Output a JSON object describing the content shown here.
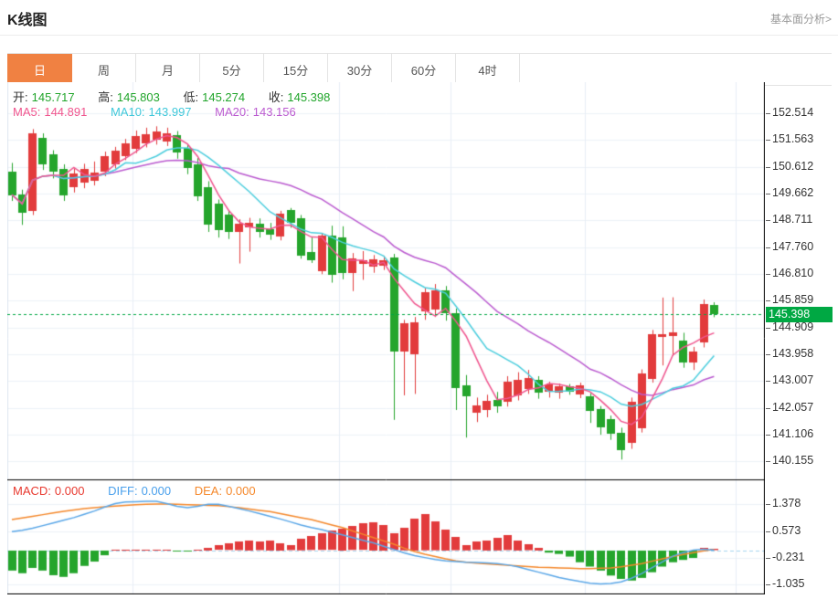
{
  "page": {
    "title": "K线图",
    "link": "基本面分析>"
  },
  "tabs": {
    "items": [
      "日",
      "周",
      "月",
      "5分",
      "15分",
      "30分",
      "60分",
      "4时"
    ],
    "active_index": 0
  },
  "ohlc": {
    "open_label": "开:",
    "open": "145.717",
    "high_label": "高:",
    "high": "145.803",
    "low_label": "低:",
    "low": "145.274",
    "close_label": "收:",
    "close": "145.398"
  },
  "ma_legend": {
    "ma5_label": "MA5:",
    "ma5": "144.891",
    "ma10_label": "MA10:",
    "ma10": "143.997",
    "ma20_label": "MA20:",
    "ma20": "143.156"
  },
  "macd_legend": {
    "macd_label": "MACD:",
    "macd": "0.000",
    "diff_label": "DIFF:",
    "diff": "0.000",
    "dea_label": "DEA:",
    "dea": "0.000"
  },
  "price_badge": "145.398",
  "colors": {
    "up": "#e23b3c",
    "down": "#25a52c",
    "ma5": "#f0558e",
    "ma10": "#4ccede",
    "ma20": "#bb5bd0",
    "diff": "#5aa7e8",
    "dea": "#f5882b",
    "badge_bg": "#00a843",
    "price_line": "#00a843",
    "grid": "#edf2f8",
    "vgrid": "#e8eef6",
    "axis": "#000000",
    "zero_dash": "#a5d5f0",
    "tab_accent": "#f08142"
  },
  "chart_data": {
    "type": "candlestick",
    "title": "K线图 (日K)",
    "price_axis_ticks": [
      "152.514",
      "151.563",
      "150.612",
      "149.662",
      "148.711",
      "147.760",
      "146.810",
      "145.859",
      "144.909",
      "143.958",
      "143.007",
      "142.057",
      "141.106",
      "140.155"
    ],
    "price_tick_top": 152.514,
    "price_tick_step": 0.9507,
    "macd_axis_ticks": [
      "1.378",
      "0.573",
      "-0.231",
      "-1.035"
    ],
    "current_price": 145.398,
    "ma_periods": [
      5,
      10,
      20
    ],
    "legend": [
      "MA5",
      "MA10",
      "MA20",
      "MACD",
      "DIFF",
      "DEA"
    ],
    "candles_ohlc": [
      [
        150.45,
        150.75,
        149.4,
        149.62
      ],
      [
        149.62,
        149.8,
        148.55,
        148.98
      ],
      [
        149.05,
        151.95,
        148.9,
        151.8
      ],
      [
        151.65,
        151.8,
        150.5,
        150.72
      ],
      [
        151.05,
        151.2,
        150.2,
        150.42
      ],
      [
        150.55,
        150.7,
        149.4,
        149.62
      ],
      [
        149.9,
        150.55,
        149.7,
        150.38
      ],
      [
        150.05,
        150.72,
        149.85,
        150.55
      ],
      [
        150.12,
        150.8,
        149.95,
        150.42
      ],
      [
        150.42,
        151.15,
        150.28,
        150.98
      ],
      [
        150.7,
        151.32,
        150.55,
        151.18
      ],
      [
        151.0,
        151.6,
        150.85,
        151.45
      ],
      [
        151.25,
        151.9,
        151.1,
        151.7
      ],
      [
        151.45,
        152.0,
        151.3,
        151.78
      ],
      [
        151.55,
        152.05,
        151.4,
        151.85
      ],
      [
        151.5,
        152.0,
        151.35,
        151.8
      ],
      [
        151.72,
        151.88,
        150.9,
        151.1
      ],
      [
        151.28,
        151.4,
        150.35,
        150.58
      ],
      [
        150.7,
        150.92,
        149.4,
        149.55
      ],
      [
        149.88,
        150.1,
        148.3,
        148.55
      ],
      [
        149.3,
        149.45,
        148.1,
        148.35
      ],
      [
        148.9,
        149.05,
        148.05,
        148.28
      ],
      [
        148.3,
        148.75,
        147.18,
        148.58
      ],
      [
        148.45,
        148.8,
        147.6,
        148.62
      ],
      [
        148.6,
        148.78,
        148.1,
        148.3
      ],
      [
        148.4,
        148.62,
        148.02,
        148.22
      ],
      [
        148.15,
        149.05,
        148.0,
        148.95
      ],
      [
        149.08,
        149.15,
        148.45,
        148.62
      ],
      [
        148.8,
        148.9,
        147.35,
        147.48
      ],
      [
        147.6,
        148.1,
        147.2,
        147.32
      ],
      [
        146.92,
        148.25,
        146.8,
        148.18
      ],
      [
        148.18,
        148.52,
        146.5,
        146.78
      ],
      [
        148.12,
        148.5,
        146.62,
        146.85
      ],
      [
        146.82,
        147.55,
        146.2,
        147.35
      ],
      [
        147.18,
        147.62,
        146.6,
        147.3
      ],
      [
        147.05,
        147.48,
        146.85,
        147.32
      ],
      [
        147.1,
        147.45,
        146.95,
        147.28
      ],
      [
        147.38,
        147.52,
        141.63,
        144.05
      ],
      [
        144.04,
        145.18,
        142.5,
        145.05
      ],
      [
        143.98,
        145.28,
        142.55,
        145.1
      ],
      [
        145.48,
        146.32,
        145.18,
        146.15
      ],
      [
        145.55,
        146.45,
        145.28,
        146.22
      ],
      [
        146.22,
        146.38,
        145.15,
        145.42
      ],
      [
        145.4,
        145.58,
        141.98,
        142.75
      ],
      [
        142.85,
        143.22,
        141.0,
        142.45
      ],
      [
        141.88,
        142.42,
        141.55,
        142.15
      ],
      [
        141.98,
        142.52,
        141.72,
        142.3
      ],
      [
        142.32,
        142.62,
        141.88,
        142.08
      ],
      [
        142.28,
        143.18,
        142.1,
        142.98
      ],
      [
        142.5,
        143.32,
        142.32,
        143.05
      ],
      [
        142.72,
        143.4,
        142.55,
        143.12
      ],
      [
        143.05,
        143.18,
        142.38,
        142.58
      ],
      [
        142.62,
        142.98,
        142.42,
        142.88
      ],
      [
        142.58,
        142.92,
        142.38,
        142.82
      ],
      [
        142.82,
        142.9,
        142.52,
        142.62
      ],
      [
        142.52,
        142.95,
        142.4,
        142.85
      ],
      [
        142.48,
        142.58,
        141.52,
        141.95
      ],
      [
        142.02,
        142.12,
        141.1,
        141.38
      ],
      [
        141.65,
        141.78,
        140.92,
        141.12
      ],
      [
        141.18,
        141.35,
        140.22,
        140.58
      ],
      [
        140.82,
        142.42,
        140.6,
        142.28
      ],
      [
        141.32,
        143.42,
        141.18,
        143.28
      ],
      [
        143.1,
        144.82,
        142.95,
        144.68
      ],
      [
        144.55,
        145.97,
        143.56,
        144.66
      ],
      [
        144.58,
        145.98,
        143.9,
        144.72
      ],
      [
        144.45,
        144.72,
        143.48,
        143.66
      ],
      [
        143.66,
        144.22,
        143.4,
        144.06
      ],
      [
        144.39,
        145.9,
        144.2,
        145.74
      ],
      [
        145.717,
        145.803,
        145.274,
        145.398
      ]
    ],
    "macd": {
      "hist": [
        -0.6,
        -0.68,
        -0.52,
        -0.6,
        -0.74,
        -0.79,
        -0.68,
        -0.46,
        -0.33,
        -0.14,
        0.02,
        0.03,
        0.02,
        0.02,
        0.01,
        0.01,
        -0.01,
        -0.02,
        0.01,
        0.08,
        0.14,
        0.2,
        0.26,
        0.3,
        0.26,
        0.3,
        0.22,
        0.15,
        0.35,
        0.42,
        0.5,
        0.58,
        0.66,
        0.72,
        0.8,
        0.85,
        0.77,
        0.5,
        0.68,
        0.96,
        1.09,
        0.87,
        0.63,
        0.4,
        0.16,
        0.25,
        0.3,
        0.38,
        0.45,
        0.3,
        0.18,
        0.08,
        -0.06,
        -0.1,
        -0.18,
        -0.35,
        -0.48,
        -0.6,
        -0.75,
        -0.85,
        -0.9,
        -0.82,
        -0.65,
        -0.48,
        -0.35,
        -0.28,
        -0.22,
        0.06,
        0.04
      ],
      "diff": [
        0.56,
        0.6,
        0.66,
        0.74,
        0.82,
        0.9,
        0.98,
        1.08,
        1.18,
        1.3,
        1.4,
        1.45,
        1.46,
        1.47,
        1.47,
        1.4,
        1.32,
        1.28,
        1.32,
        1.38,
        1.38,
        1.32,
        1.25,
        1.18,
        1.1,
        1.02,
        0.94,
        0.85,
        0.76,
        0.68,
        0.62,
        0.54,
        0.46,
        0.38,
        0.3,
        0.22,
        0.12,
        0.02,
        -0.08,
        -0.16,
        -0.22,
        -0.28,
        -0.32,
        -0.34,
        -0.36,
        -0.37,
        -0.38,
        -0.4,
        -0.44,
        -0.5,
        -0.58,
        -0.66,
        -0.74,
        -0.82,
        -0.88,
        -0.94,
        -0.99,
        -1.01,
        -1.0,
        -0.95,
        -0.84,
        -0.7,
        -0.52,
        -0.35,
        -0.18,
        -0.07,
        0.0,
        0.03,
        0.0
      ],
      "dea": [
        0.92,
        0.97,
        1.02,
        1.07,
        1.12,
        1.17,
        1.21,
        1.25,
        1.28,
        1.31,
        1.33,
        1.35,
        1.37,
        1.38,
        1.39,
        1.39,
        1.38,
        1.37,
        1.36,
        1.35,
        1.34,
        1.31,
        1.28,
        1.24,
        1.2,
        1.16,
        1.1,
        1.04,
        0.98,
        0.92,
        0.84,
        0.76,
        0.68,
        0.58,
        0.48,
        0.38,
        0.28,
        0.18,
        0.06,
        -0.04,
        -0.12,
        -0.19,
        -0.26,
        -0.32,
        -0.36,
        -0.39,
        -0.41,
        -0.43,
        -0.45,
        -0.47,
        -0.49,
        -0.51,
        -0.52,
        -0.53,
        -0.54,
        -0.55,
        -0.55,
        -0.54,
        -0.53,
        -0.5,
        -0.45,
        -0.4,
        -0.33,
        -0.26,
        -0.19,
        -0.13,
        -0.07,
        -0.02,
        0.02
      ]
    }
  }
}
